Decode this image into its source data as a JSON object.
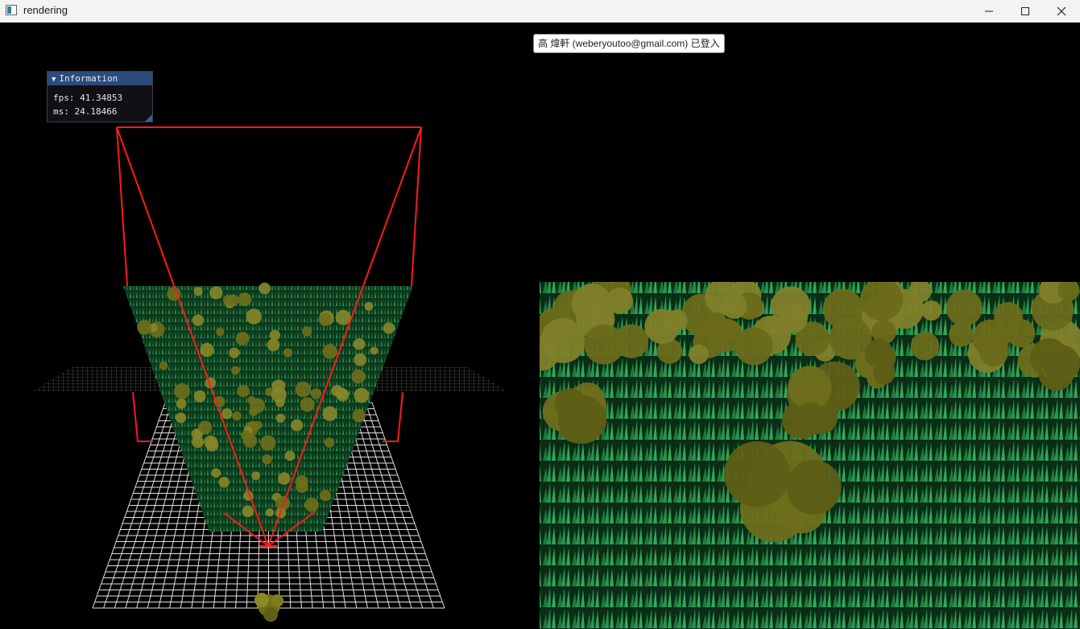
{
  "window": {
    "title": "rendering",
    "icon": "app-window-icon"
  },
  "controls": {
    "minimize": "minimize-icon",
    "maximize": "maximize-icon",
    "close": "close-icon"
  },
  "notification": {
    "text": "高 煒軒 (weberyoutoo@gmail.com) 已登入"
  },
  "info_panel": {
    "title": "Information",
    "fps_line": "fps: 41.34853",
    "ms_line": "ms: 24.18466"
  },
  "colors": {
    "frustum": "#ff1a1a",
    "grid": "#e0e0e0",
    "grass_dark": "#0d3a1c",
    "grass_light": "#2c9a52",
    "bush": "#7a7a1c"
  }
}
